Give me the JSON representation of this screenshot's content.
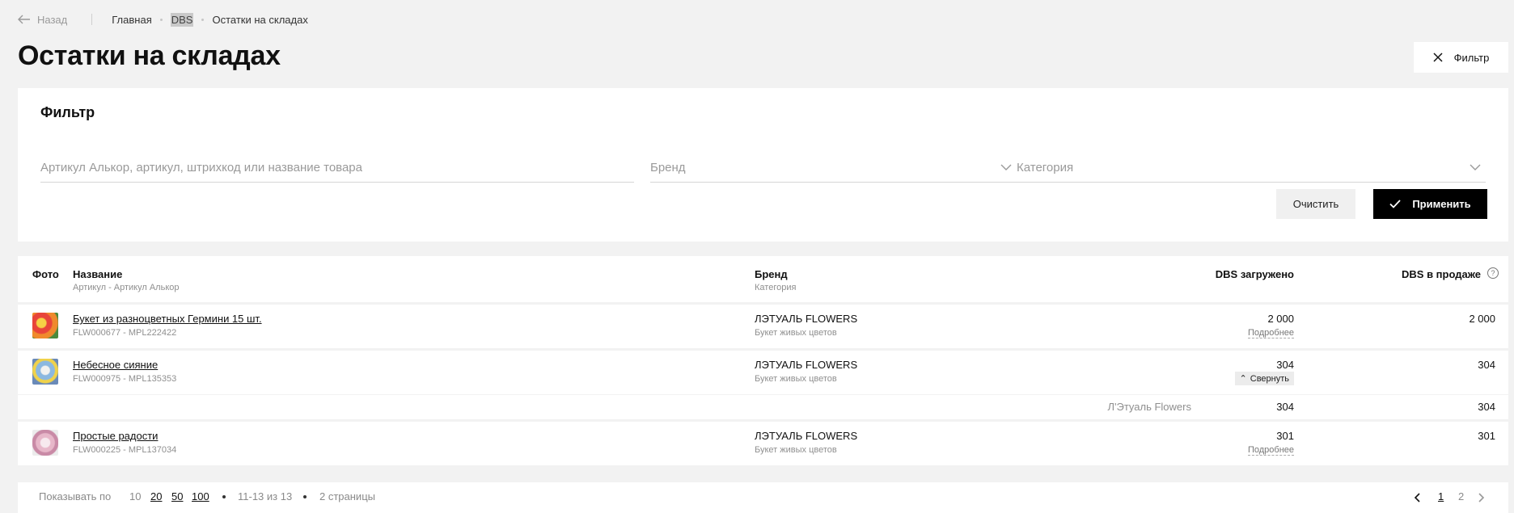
{
  "topbar": {
    "back_label": "Назад",
    "breadcrumbs": [
      "Главная",
      "DBS",
      "Остатки на складах"
    ]
  },
  "page_title": "Остатки на складах",
  "filter_toggle_label": "Фильтр",
  "filter": {
    "title": "Фильтр",
    "search_placeholder": "Артикул Алькор, артикул, штрихкод или название товара",
    "brand_placeholder": "Бренд",
    "category_placeholder": "Категория",
    "clear_label": "Очистить",
    "apply_label": "Применить"
  },
  "table": {
    "headers": {
      "photo": "Фото",
      "name": "Название",
      "name_sub": "Артикул - Артикул Алькор",
      "brand": "Бренд",
      "brand_sub": "Категория",
      "loaded": "DBS загружено",
      "on_sale": "DBS в продаже"
    },
    "rows": [
      {
        "name": "Букет из разноцветных Гермини 15 шт.",
        "sku": "FLW000677 - MPL222422",
        "brand": "ЛЭТУАЛЬ FLOWERS",
        "category": "Букет живых цветов",
        "loaded": "2 000",
        "action": "Подробнее",
        "on_sale": "2 000"
      },
      {
        "name": "Небесное сияние",
        "sku": "FLW000975 - MPL135353",
        "brand": "ЛЭТУАЛЬ FLOWERS",
        "category": "Букет живых цветов",
        "loaded": "304",
        "action": "Свернуть",
        "on_sale": "304"
      },
      {
        "name": "Простые радости",
        "sku": "FLW000225 - MPL137034",
        "brand": "ЛЭТУАЛЬ FLOWERS",
        "category": "Букет живых цветов",
        "loaded": "301",
        "action": "Подробнее",
        "on_sale": "301"
      }
    ],
    "subrow": {
      "warehouse": "Л'Этуаль Flowers",
      "loaded": "304",
      "on_sale": "304"
    }
  },
  "pager": {
    "show_label": "Показывать по",
    "sizes": [
      "10",
      "20",
      "50",
      "100"
    ],
    "range": "11-13 из 13",
    "pages_count": "2 страницы",
    "pages": [
      "1",
      "2"
    ]
  }
}
